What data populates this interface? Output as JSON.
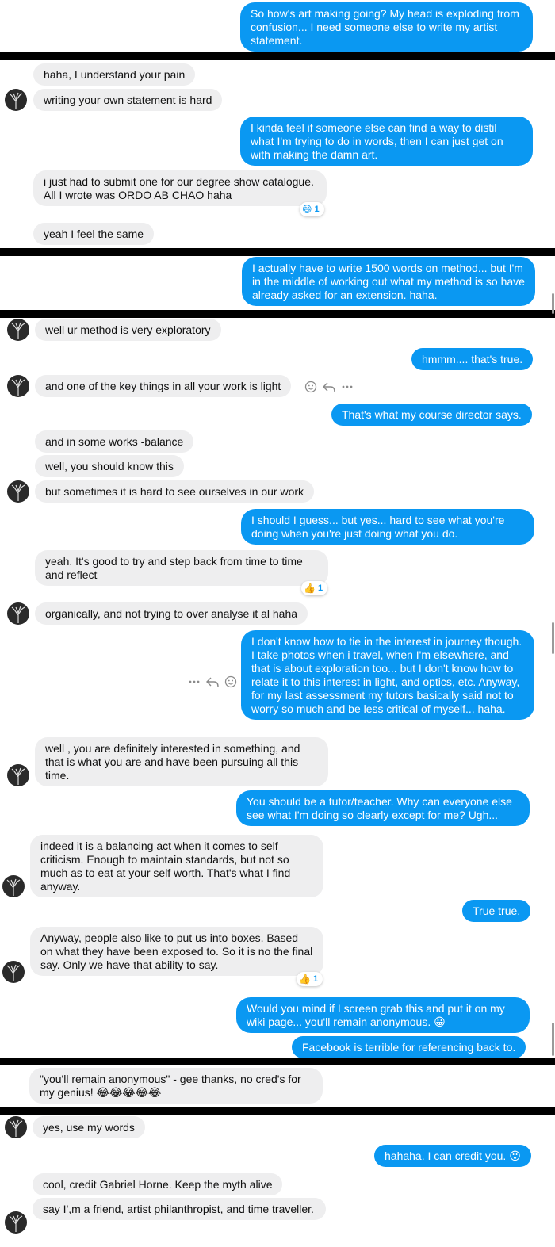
{
  "colors": {
    "outgoing": "#0a98f2",
    "incoming": "#eeeeef",
    "separator": "#000000"
  },
  "messages": {
    "m1": "So how's art making going? My head is exploding from confusion... I need someone else to write my artist statement.",
    "m2": "haha, I understand your pain",
    "m3": "writing your own statement is hard",
    "m4": "I kinda feel if someone else can find a way to distil what I'm trying to do in words, then I can just get on with making the damn art.",
    "m5": "i just had to submit one for our degree show catalogue. All I wrote was ORDO AB CHAO haha",
    "m6": "yeah I feel the same",
    "m7": "I actually have to write 1500 words on method... but I'm in the middle of working out what my method is so have already asked for an extension. haha.",
    "m8": "well ur method is very exploratory",
    "m9": "hmmm.... that's true.",
    "m10": "and one of the key things in all your work is light",
    "m11": "That's what my course director says.",
    "m12": "and in some works -balance",
    "m13": "well, you should know this",
    "m14": "but sometimes it is hard to see ourselves in our work",
    "m15": "I should I guess... but yes... hard to see what you're doing when you're just doing what you do.",
    "m16": "yeah. It's good to try and step back from time to time and reflect",
    "m17": "organically, and not trying to over analyse it al haha",
    "m18": "I don't know how to tie in the interest in journey though. I take photos when i travel, when I'm elsewhere, and that is about exploration too... but I don't know how to relate it to this interest in light, and optics, etc. Anyway, for my last assessment my tutors basically said not to worry so much and be less critical of myself... haha.",
    "m19": "well , you are definitely interested in something, and that is what you are and have been pursuing all this time.",
    "m20": "You should be a tutor/teacher. Why can everyone else see what I'm doing so clearly except for me? Ugh...",
    "m21": "indeed it is a balancing act when it comes to self criticism. Enough to maintain standards, but not so much as to eat at your self worth. That's what I find anyway.",
    "m22": "True true.",
    "m23": "Anyway, people also like to put us into boxes. Based on what they have been exposed to. So it is no the final say. Only we have that ability to say.",
    "m24": "Would you mind if I screen grab this and put it on my wiki page... you'll remain anonymous. 😀",
    "m25": "Facebook is terrible for referencing back to.",
    "m26": "\"you'll remain anonymous\" - gee thanks, no cred's for my genius! 😂😂😂😂😂",
    "m27": "yes, use my words",
    "m28": "hahaha. I can credit you. 😛",
    "m29": "cool, credit Gabriel Horne. Keep the myth alive",
    "m30": "say I',m a friend, artist philanthropist, and time traveller."
  },
  "reactions": {
    "r1": {
      "emoji": "😄",
      "count": "1"
    },
    "r2": {
      "emoji": "👍",
      "count": "1"
    },
    "r3": {
      "emoji": "👍",
      "count": "1"
    }
  },
  "icons": {
    "react": "smiley-icon",
    "reply": "reply-icon",
    "more": "more-icon"
  }
}
